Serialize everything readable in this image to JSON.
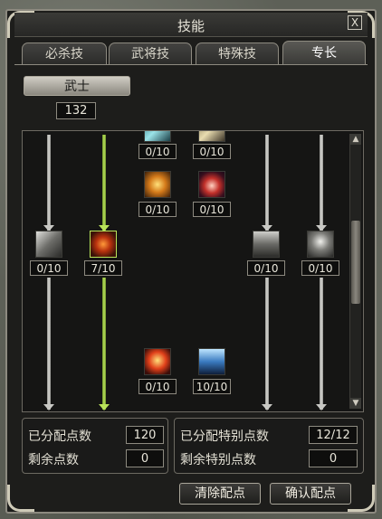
{
  "window": {
    "title": "技能",
    "close_label": "X"
  },
  "tabs": [
    {
      "label": "必杀技",
      "active": false
    },
    {
      "label": "武将技",
      "active": false
    },
    {
      "label": "特殊技",
      "active": false
    },
    {
      "label": "专长",
      "active": true
    }
  ],
  "class_button": {
    "label": "武士"
  },
  "available_points": "132",
  "skills": {
    "top_left": {
      "level": "0/10",
      "icon": "ice-skill-icon"
    },
    "top_right": {
      "level": "0/10",
      "icon": "sword-skill-icon"
    },
    "mid_a": {
      "level": "0/10",
      "icon": "spear-strike-icon"
    },
    "mid_b": {
      "level": "0/10",
      "icon": "fire-ring-icon"
    },
    "row_1": {
      "level": "0/10",
      "icon": "claw-skill-icon"
    },
    "row_2": {
      "level": "7/10",
      "icon": "flame-skull-icon"
    },
    "row_3": {
      "level": "0/10",
      "icon": "wind-slash-icon"
    },
    "row_4": {
      "level": "0/10",
      "icon": "storm-skill-icon"
    },
    "bottom_a": {
      "level": "0/10",
      "icon": "flame-body-icon"
    },
    "bottom_b": {
      "level": "10/10",
      "icon": "blue-aura-icon"
    }
  },
  "stats": {
    "assigned_label": "已分配点数",
    "assigned_value": "120",
    "remaining_label": "剩余点数",
    "remaining_value": "0",
    "special_assigned_label": "已分配特别点数",
    "special_assigned_value": "12/12",
    "special_remaining_label": "剩余特别点数",
    "special_remaining_value": "0"
  },
  "buttons": {
    "clear": "清除配点",
    "confirm": "确认配点"
  }
}
